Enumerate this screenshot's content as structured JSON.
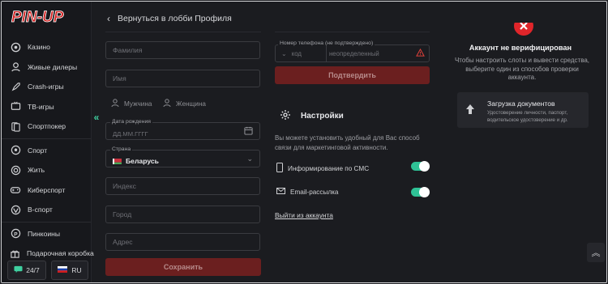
{
  "brand": {
    "logo_text": "PIN-UP",
    "accent": "#d21c1c",
    "toggle_color": "#2fc296"
  },
  "header": {
    "back_label": "Вернуться в лобби Профиля"
  },
  "sidebar": {
    "items": [
      {
        "label": "Казино",
        "icon": "casino-chip-icon"
      },
      {
        "label": "Живые дилеры",
        "icon": "live-dealer-icon"
      },
      {
        "label": "Crash-игры",
        "icon": "rocket-icon"
      },
      {
        "label": "ТВ-игры",
        "icon": "tv-icon"
      },
      {
        "label": "Спортпокер",
        "icon": "cards-icon"
      },
      {
        "label": "Спорт",
        "icon": "soccer-ball-icon"
      },
      {
        "label": "Жить",
        "icon": "live-icon"
      },
      {
        "label": "Киберспорт",
        "icon": "gamepad-icon"
      },
      {
        "label": "В-спорт",
        "icon": "vsport-icon"
      },
      {
        "label": "Пинкоины",
        "icon": "pincoin-icon"
      },
      {
        "label": "Подарочная коробка",
        "icon": "gift-icon"
      }
    ],
    "support_label": "24/7",
    "language_label": "RU"
  },
  "form": {
    "surname_placeholder": "Фамилия",
    "name_placeholder": "Имя",
    "gender_male": "Мужчина",
    "gender_female": "Женщина",
    "dob_label": "Дата рождения",
    "dob_placeholder": "ДД.ММ.ГГГГ",
    "country_label": "Страна",
    "country_value": "Беларусь",
    "postcode_placeholder": "Индекс",
    "city_placeholder": "Город",
    "address_placeholder": "Адрес",
    "save_label": "Сохранить"
  },
  "phone": {
    "label": "Номер телефона (не подтверждено)",
    "code_placeholder": "код",
    "number_placeholder": "неопределенный",
    "confirm_label": "Подтвердить"
  },
  "settings": {
    "title": "Настройки",
    "description": "Вы можете установить удобный для Вас способ связи для маркетинговой активности.",
    "sms_label": "Информирование по СМС",
    "sms_on": true,
    "email_label": "Email-рассылка",
    "email_on": true,
    "logout_label": "Выйти из аккаунта"
  },
  "verification": {
    "title": "Аккаунт не верифицирован",
    "text": "Чтобы настроить слоты и вывести средства, выберите один из способов проверки аккаунта.",
    "upload_title": "Загрузка документов",
    "upload_desc": "Удостоверение личности, паспорт, водительское удостоверение и др."
  }
}
